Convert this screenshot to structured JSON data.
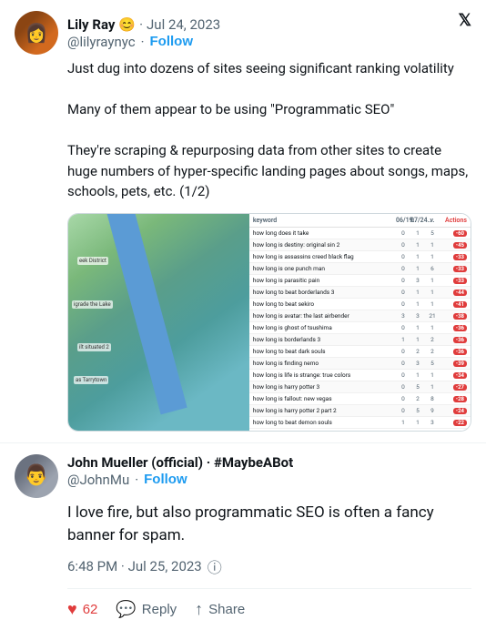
{
  "tweet1": {
    "displayName": "Lily Ray",
    "emoji": "😊",
    "timestamp": "Jul 24, 2023",
    "username": "@lilyraynyc",
    "follow": "Follow",
    "text_line1": "Just dug into dozens of sites seeing significant ranking volatility",
    "text_line2": "Many of them appear to be using \"Programmatic SEO\"",
    "text_line3": "They're scraping & repurposing data from other sites to create huge numbers of hyper-specific landing pages about songs, maps, schools, pets, etc. (1/2)",
    "xIcon": "✕",
    "table": {
      "header": [
        "",
        "06/19..",
        "07/24..",
        "",
        "Actions"
      ],
      "rows": [
        {
          "label": "how long does it take",
          "n1": "0",
          "n2": "1",
          "n3": "5",
          "badge": "-60",
          "color": "red"
        },
        {
          "label": "how long is destiny: original sin 2",
          "n1": "0",
          "n2": "1",
          "n3": "1",
          "badge": "-45",
          "color": "red"
        },
        {
          "label": "how long is assassins creed black flag",
          "n1": "0",
          "n2": "1",
          "n3": "1",
          "badge": "-33",
          "color": "red"
        },
        {
          "label": "how long is one punch man",
          "n1": "0",
          "n2": "1",
          "n3": "6",
          "badge": "-33",
          "color": "red"
        },
        {
          "label": "how long is parasitic pain",
          "n1": "0",
          "n2": "3",
          "n3": "1",
          "badge": "-33",
          "color": "red"
        },
        {
          "label": "how long to beat borderlands 3",
          "n1": "0",
          "n2": "1",
          "n3": "1",
          "badge": "-44",
          "color": "red"
        },
        {
          "label": "how long to beat sekiro",
          "n1": "0",
          "n2": "1",
          "n3": "1",
          "badge": "-41",
          "color": "red"
        },
        {
          "label": "how long is avatar: the last airbender",
          "n1": "3",
          "n2": "3",
          "n3": "21",
          "badge": "-38",
          "color": "red"
        },
        {
          "label": "how long is ghost of tsushima",
          "n1": "0",
          "n2": "1",
          "n3": "1",
          "badge": "-36",
          "color": "red"
        },
        {
          "label": "how long is borderlands 3",
          "n1": "1",
          "n2": "1",
          "n3": "2",
          "badge": "-36",
          "color": "red"
        },
        {
          "label": "how long to beat dark souls",
          "n1": "0",
          "n2": "2",
          "n3": "2",
          "badge": "-36",
          "color": "red"
        },
        {
          "label": "how long is finding nemo",
          "n1": "0",
          "n2": "3",
          "n3": "5",
          "badge": "-39",
          "color": "red"
        },
        {
          "label": "how long is life is strange: true colors",
          "n1": "0",
          "n2": "1",
          "n3": "1",
          "badge": "-34",
          "color": "red"
        },
        {
          "label": "how long is harry potter 3",
          "n1": "0",
          "n2": "5",
          "n3": "1",
          "badge": "-27",
          "color": "red"
        },
        {
          "label": "how long is fallout: new vegas",
          "n1": "0",
          "n2": "2",
          "n3": "8",
          "badge": "-28",
          "color": "red"
        },
        {
          "label": "how long is harry potter 2 part 2",
          "n1": "0",
          "n2": "5",
          "n3": "9",
          "badge": "-24",
          "color": "red"
        },
        {
          "label": "how long to beat demon souls",
          "n1": "1",
          "n2": "1",
          "n3": "3",
          "badge": "-22",
          "color": "red"
        }
      ]
    }
  },
  "tweet2": {
    "displayName": "John Mueller (official) · #MaybeABot",
    "username": "@JohnMu",
    "follow": "Follow",
    "text": "I love fire, but also programmatic SEO is often a fancy banner for spam.",
    "timestamp": "6:48 PM · Jul 25, 2023",
    "actions": {
      "like_count": "62",
      "like_label": "62",
      "reply_label": "Reply",
      "share_label": "Share"
    }
  }
}
